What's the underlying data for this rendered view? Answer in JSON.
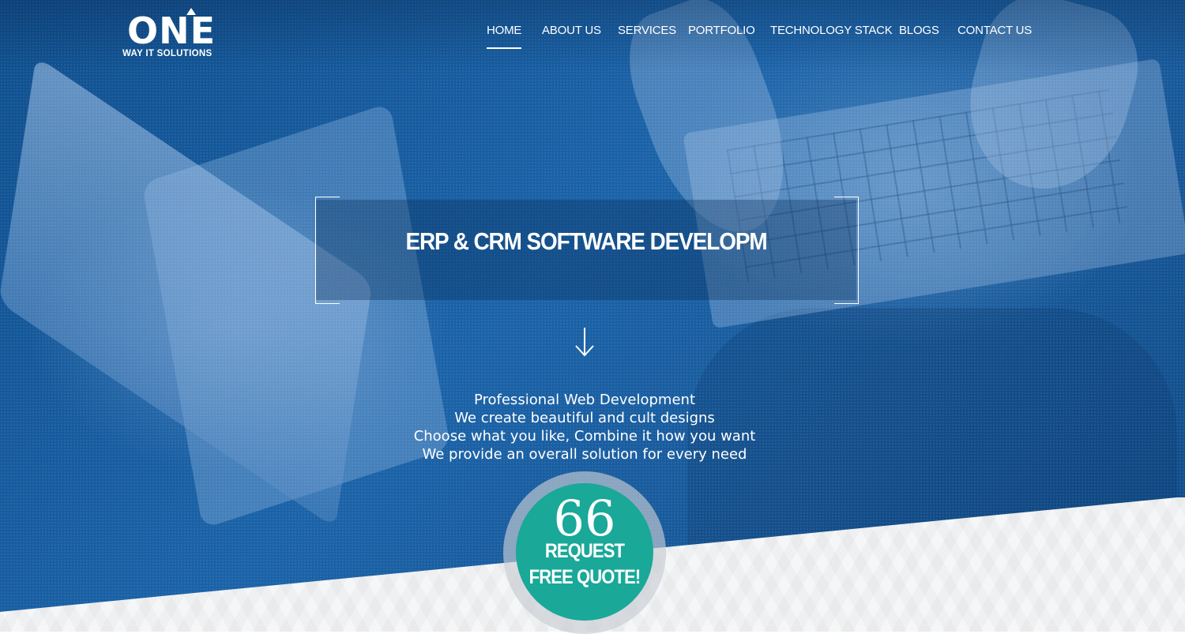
{
  "brand": {
    "logo_word": "ONE",
    "tagline": "WAY IT SOLUTIONS"
  },
  "nav": {
    "items": [
      {
        "label": "HOME",
        "active": true
      },
      {
        "label": "ABOUT US",
        "active": false
      },
      {
        "label": "SERVICES",
        "active": false
      },
      {
        "label": "PORTFOLIO",
        "active": false
      },
      {
        "label": "TECHNOLOGY STACK",
        "active": false
      },
      {
        "label": "BLOGS",
        "active": false
      },
      {
        "label": "CONTACT US",
        "active": false
      }
    ]
  },
  "hero": {
    "headline": "ERP & CRM SOFTWARE DEVELOPM",
    "lines": [
      "Professional Web Development",
      "We create beautiful and cult designs",
      "Choose what you like, Combine it how you want",
      "We provide an overall solution for every need"
    ]
  },
  "cta": {
    "glyph": "66",
    "line1": "REQUEST",
    "line2": "FREE QUOTE!"
  },
  "colors": {
    "hero_blue": "#1b63a8",
    "cta_teal": "#1aa898",
    "text": "#ffffff"
  },
  "icons": {
    "scroll": "down-arrow-icon",
    "quote": "quote-icon"
  }
}
